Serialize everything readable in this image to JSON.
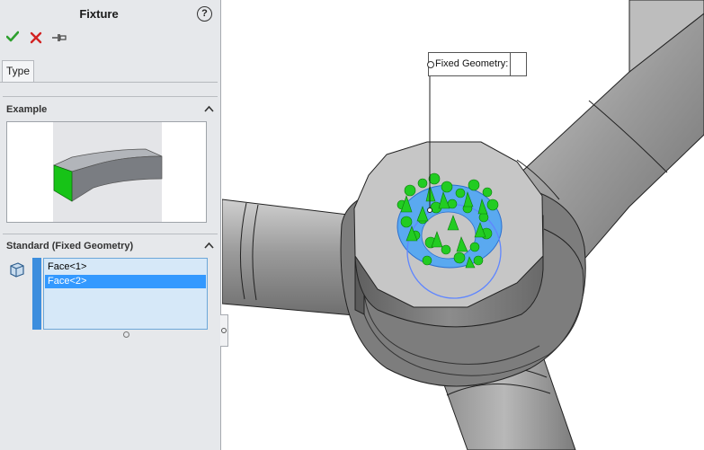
{
  "panel": {
    "title": "Fixture",
    "help_glyph": "?",
    "toolbar": {
      "ok_icon": "check-icon",
      "cancel_icon": "x-icon",
      "pin_icon": "pushpin-icon"
    },
    "tab": "Type",
    "example": {
      "title": "Example"
    },
    "standard": {
      "title": "Standard (Fixed Geometry)",
      "items": [
        {
          "label": "Face<1>"
        },
        {
          "label": "Face<2>"
        }
      ],
      "selected_index": 1
    }
  },
  "viewport": {
    "callout_label": "Fixed Geometry:"
  },
  "colors": {
    "accent_blue": "#3399ff",
    "fixture_green": "#22cc22",
    "face_highlight": "#5aa9f0",
    "model_gray": "#9a9a9a",
    "panel_bg": "#e6e8eb"
  }
}
